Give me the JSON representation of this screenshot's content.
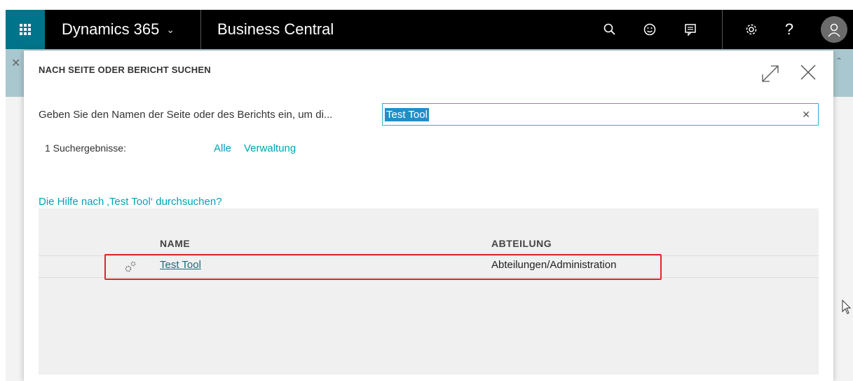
{
  "topbar": {
    "brand": "Dynamics 365",
    "app_title": "Business Central",
    "colors": {
      "bar": "#000000",
      "waffle": "#00748a"
    },
    "icons": [
      "waffle-icon",
      "search-icon",
      "smiley-icon",
      "feedback-icon",
      "gear-icon",
      "help-icon",
      "user-avatar-icon"
    ],
    "help_glyph": "?"
  },
  "dialog": {
    "title": "NACH SEITE ODER BERICHT SUCHEN",
    "prompt": "Geben Sie den Namen der Seite oder des Berichts ein, um di...",
    "search": {
      "value": "Test Tool"
    },
    "results_count": "1 Suchergebnisse:",
    "filters": [
      "Alle",
      "Verwaltung"
    ],
    "help_link": "Die Hilfe nach ‚Test Tool‘ durchsuchen?",
    "table": {
      "columns": [
        "NAME",
        "ABTEILUNG"
      ],
      "rows": [
        {
          "name": "Test Tool",
          "department": "Abteilungen/Administration",
          "icon": "gears-icon"
        }
      ]
    },
    "accent_color": "#00a3b5",
    "highlight_color": "#e0262b"
  }
}
